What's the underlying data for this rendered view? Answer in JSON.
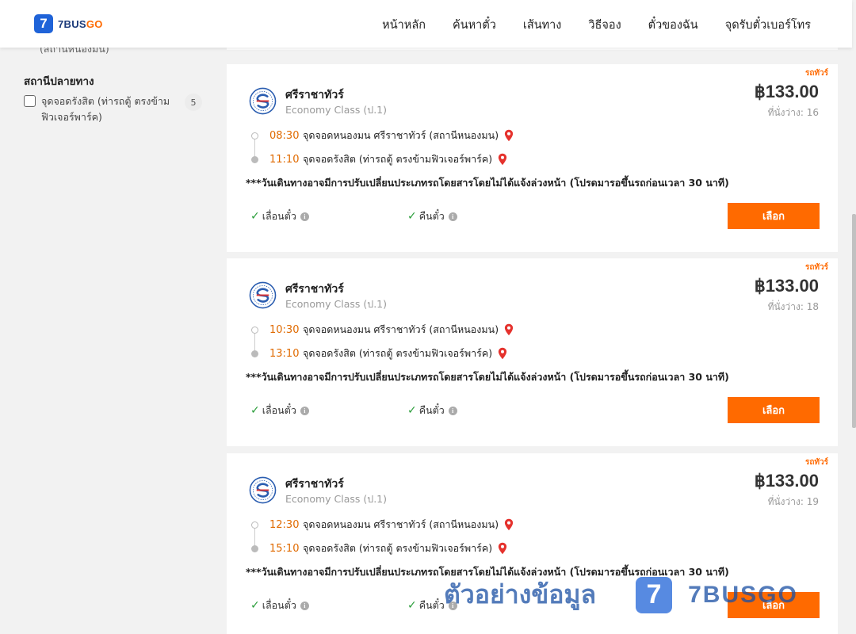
{
  "header": {
    "logo_mark": "7",
    "logo_brand": "7BUS",
    "logo_brand_suffix": "GO",
    "nav": [
      "หน้าหลัก",
      "ค้นหาตั๋ว",
      "เส้นทาง",
      "วิธีจอง",
      "ตั๋วของฉัน",
      "จุดรับตั๋วเบอร์โทร"
    ]
  },
  "sidebar": {
    "cut_text": "(สถานีหนองมน)",
    "destination_title": "สถานีปลายทาง",
    "destination_items": [
      {
        "label": "จุดจอดรังสิต (ท่ารถตู้ ตรงข้ามฟิวเจอร์พาร์ค)",
        "count": "5"
      }
    ]
  },
  "trips": [
    {
      "badge": "รถทัวร์",
      "operator": "ศรีราชาทัวร์",
      "class": "Economy Class (ป.1)",
      "price": "฿133.00",
      "seats": "ที่นั่งว่าง: 16",
      "depart_time": "08:30",
      "depart_place": "จุดจอดหนองมน ศรีราชาทัวร์ (สถานีหนองมน)",
      "arrive_time": "11:10",
      "arrive_place": "จุดจอดรังสิต (ท่ารถตู้ ตรงข้ามฟิวเจอร์พาร์ค)",
      "notice": "***วันเดินทางอาจมีการปรับเปลี่ยนประเภทรถโดยสารโดยไม่ได้แจ้งล่วงหน้า (โปรดมารอขึ้นรถก่อนเวลา 30 นาที)",
      "policy_change": "เลื่อนตั๋ว",
      "policy_refund": "คืนตั๋ว",
      "select_label": "เลือก"
    },
    {
      "badge": "รถทัวร์",
      "operator": "ศรีราชาทัวร์",
      "class": "Economy Class (ป.1)",
      "price": "฿133.00",
      "seats": "ที่นั่งว่าง: 18",
      "depart_time": "10:30",
      "depart_place": "จุดจอดหนองมน ศรีราชาทัวร์ (สถานีหนองมน)",
      "arrive_time": "13:10",
      "arrive_place": "จุดจอดรังสิต (ท่ารถตู้ ตรงข้ามฟิวเจอร์พาร์ค)",
      "notice": "***วันเดินทางอาจมีการปรับเปลี่ยนประเภทรถโดยสารโดยไม่ได้แจ้งล่วงหน้า (โปรดมารอขึ้นรถก่อนเวลา 30 นาที)",
      "policy_change": "เลื่อนตั๋ว",
      "policy_refund": "คืนตั๋ว",
      "select_label": "เลือก"
    },
    {
      "badge": "รถทัวร์",
      "operator": "ศรีราชาทัวร์",
      "class": "Economy Class (ป.1)",
      "price": "฿133.00",
      "seats": "ที่นั่งว่าง: 19",
      "depart_time": "12:30",
      "depart_place": "จุดจอดหนองมน ศรีราชาทัวร์ (สถานีหนองมน)",
      "arrive_time": "15:10",
      "arrive_place": "จุดจอดรังสิต (ท่ารถตู้ ตรงข้ามฟิวเจอร์พาร์ค)",
      "notice": "***วันเดินทางอาจมีการปรับเปลี่ยนประเภทรถโดยสารโดยไม่ได้แจ้งล่วงหน้า (โปรดมารอขึ้นรถก่อนเวลา 30 นาที)",
      "policy_change": "เลื่อนตั๋ว",
      "policy_refund": "คืนตั๋ว",
      "select_label": "เลือก"
    }
  ],
  "watermark": {
    "text": "ตัวอย่างข้อมูล",
    "mark": "7",
    "brand": "7BUSGO"
  },
  "icons": {
    "logo": "bus-operator-logo-icon",
    "pin": "map-pin-icon",
    "check": "check-icon",
    "info": "info-icon"
  },
  "colors": {
    "accent": "#ff6a00",
    "brand_blue": "#1f63d8",
    "pin_red": "#e5322d",
    "check_green": "#2a9d3a",
    "time_orange": "#e06a00"
  }
}
